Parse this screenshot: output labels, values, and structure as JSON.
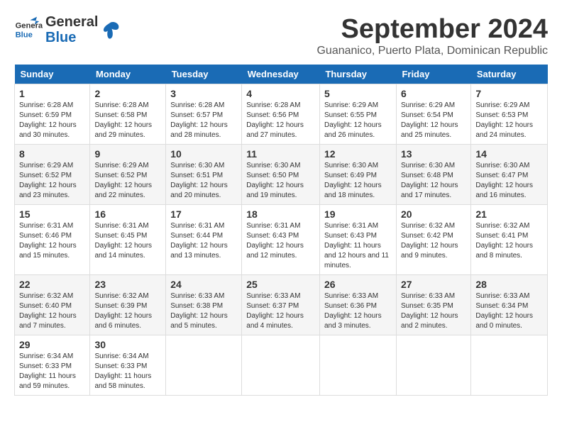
{
  "header": {
    "logo_general": "General",
    "logo_blue": "Blue",
    "month_title": "September 2024",
    "location": "Guananico, Puerto Plata, Dominican Republic"
  },
  "days_of_week": [
    "Sunday",
    "Monday",
    "Tuesday",
    "Wednesday",
    "Thursday",
    "Friday",
    "Saturday"
  ],
  "weeks": [
    [
      {
        "day": "1",
        "sunrise": "6:28 AM",
        "sunset": "6:59 PM",
        "daylight": "12 hours and 30 minutes."
      },
      {
        "day": "2",
        "sunrise": "6:28 AM",
        "sunset": "6:58 PM",
        "daylight": "12 hours and 29 minutes."
      },
      {
        "day": "3",
        "sunrise": "6:28 AM",
        "sunset": "6:57 PM",
        "daylight": "12 hours and 28 minutes."
      },
      {
        "day": "4",
        "sunrise": "6:28 AM",
        "sunset": "6:56 PM",
        "daylight": "12 hours and 27 minutes."
      },
      {
        "day": "5",
        "sunrise": "6:29 AM",
        "sunset": "6:55 PM",
        "daylight": "12 hours and 26 minutes."
      },
      {
        "day": "6",
        "sunrise": "6:29 AM",
        "sunset": "6:54 PM",
        "daylight": "12 hours and 25 minutes."
      },
      {
        "day": "7",
        "sunrise": "6:29 AM",
        "sunset": "6:53 PM",
        "daylight": "12 hours and 24 minutes."
      }
    ],
    [
      {
        "day": "8",
        "sunrise": "6:29 AM",
        "sunset": "6:52 PM",
        "daylight": "12 hours and 23 minutes."
      },
      {
        "day": "9",
        "sunrise": "6:29 AM",
        "sunset": "6:52 PM",
        "daylight": "12 hours and 22 minutes."
      },
      {
        "day": "10",
        "sunrise": "6:30 AM",
        "sunset": "6:51 PM",
        "daylight": "12 hours and 20 minutes."
      },
      {
        "day": "11",
        "sunrise": "6:30 AM",
        "sunset": "6:50 PM",
        "daylight": "12 hours and 19 minutes."
      },
      {
        "day": "12",
        "sunrise": "6:30 AM",
        "sunset": "6:49 PM",
        "daylight": "12 hours and 18 minutes."
      },
      {
        "day": "13",
        "sunrise": "6:30 AM",
        "sunset": "6:48 PM",
        "daylight": "12 hours and 17 minutes."
      },
      {
        "day": "14",
        "sunrise": "6:30 AM",
        "sunset": "6:47 PM",
        "daylight": "12 hours and 16 minutes."
      }
    ],
    [
      {
        "day": "15",
        "sunrise": "6:31 AM",
        "sunset": "6:46 PM",
        "daylight": "12 hours and 15 minutes."
      },
      {
        "day": "16",
        "sunrise": "6:31 AM",
        "sunset": "6:45 PM",
        "daylight": "12 hours and 14 minutes."
      },
      {
        "day": "17",
        "sunrise": "6:31 AM",
        "sunset": "6:44 PM",
        "daylight": "12 hours and 13 minutes."
      },
      {
        "day": "18",
        "sunrise": "6:31 AM",
        "sunset": "6:43 PM",
        "daylight": "12 hours and 12 minutes."
      },
      {
        "day": "19",
        "sunrise": "6:31 AM",
        "sunset": "6:43 PM",
        "daylight": "12 hours and 11 minutes."
      },
      {
        "day": "20",
        "sunrise": "6:32 AM",
        "sunset": "6:42 PM",
        "daylight": "12 hours and 9 minutes."
      },
      {
        "day": "21",
        "sunrise": "6:32 AM",
        "sunset": "6:41 PM",
        "daylight": "12 hours and 8 minutes."
      }
    ],
    [
      {
        "day": "22",
        "sunrise": "6:32 AM",
        "sunset": "6:40 PM",
        "daylight": "12 hours and 7 minutes."
      },
      {
        "day": "23",
        "sunrise": "6:32 AM",
        "sunset": "6:39 PM",
        "daylight": "12 hours and 6 minutes."
      },
      {
        "day": "24",
        "sunrise": "6:33 AM",
        "sunset": "6:38 PM",
        "daylight": "12 hours and 5 minutes."
      },
      {
        "day": "25",
        "sunrise": "6:33 AM",
        "sunset": "6:37 PM",
        "daylight": "12 hours and 4 minutes."
      },
      {
        "day": "26",
        "sunrise": "6:33 AM",
        "sunset": "6:36 PM",
        "daylight": "12 hours and 3 minutes."
      },
      {
        "day": "27",
        "sunrise": "6:33 AM",
        "sunset": "6:35 PM",
        "daylight": "12 hours and 2 minutes."
      },
      {
        "day": "28",
        "sunrise": "6:33 AM",
        "sunset": "6:34 PM",
        "daylight": "12 hours and 0 minutes."
      }
    ],
    [
      {
        "day": "29",
        "sunrise": "6:34 AM",
        "sunset": "6:33 PM",
        "daylight": "11 hours and 59 minutes."
      },
      {
        "day": "30",
        "sunrise": "6:34 AM",
        "sunset": "6:33 PM",
        "daylight": "11 hours and 58 minutes."
      },
      null,
      null,
      null,
      null,
      null
    ]
  ],
  "labels": {
    "sunrise": "Sunrise:",
    "sunset": "Sunset:",
    "daylight": "Daylight:"
  }
}
